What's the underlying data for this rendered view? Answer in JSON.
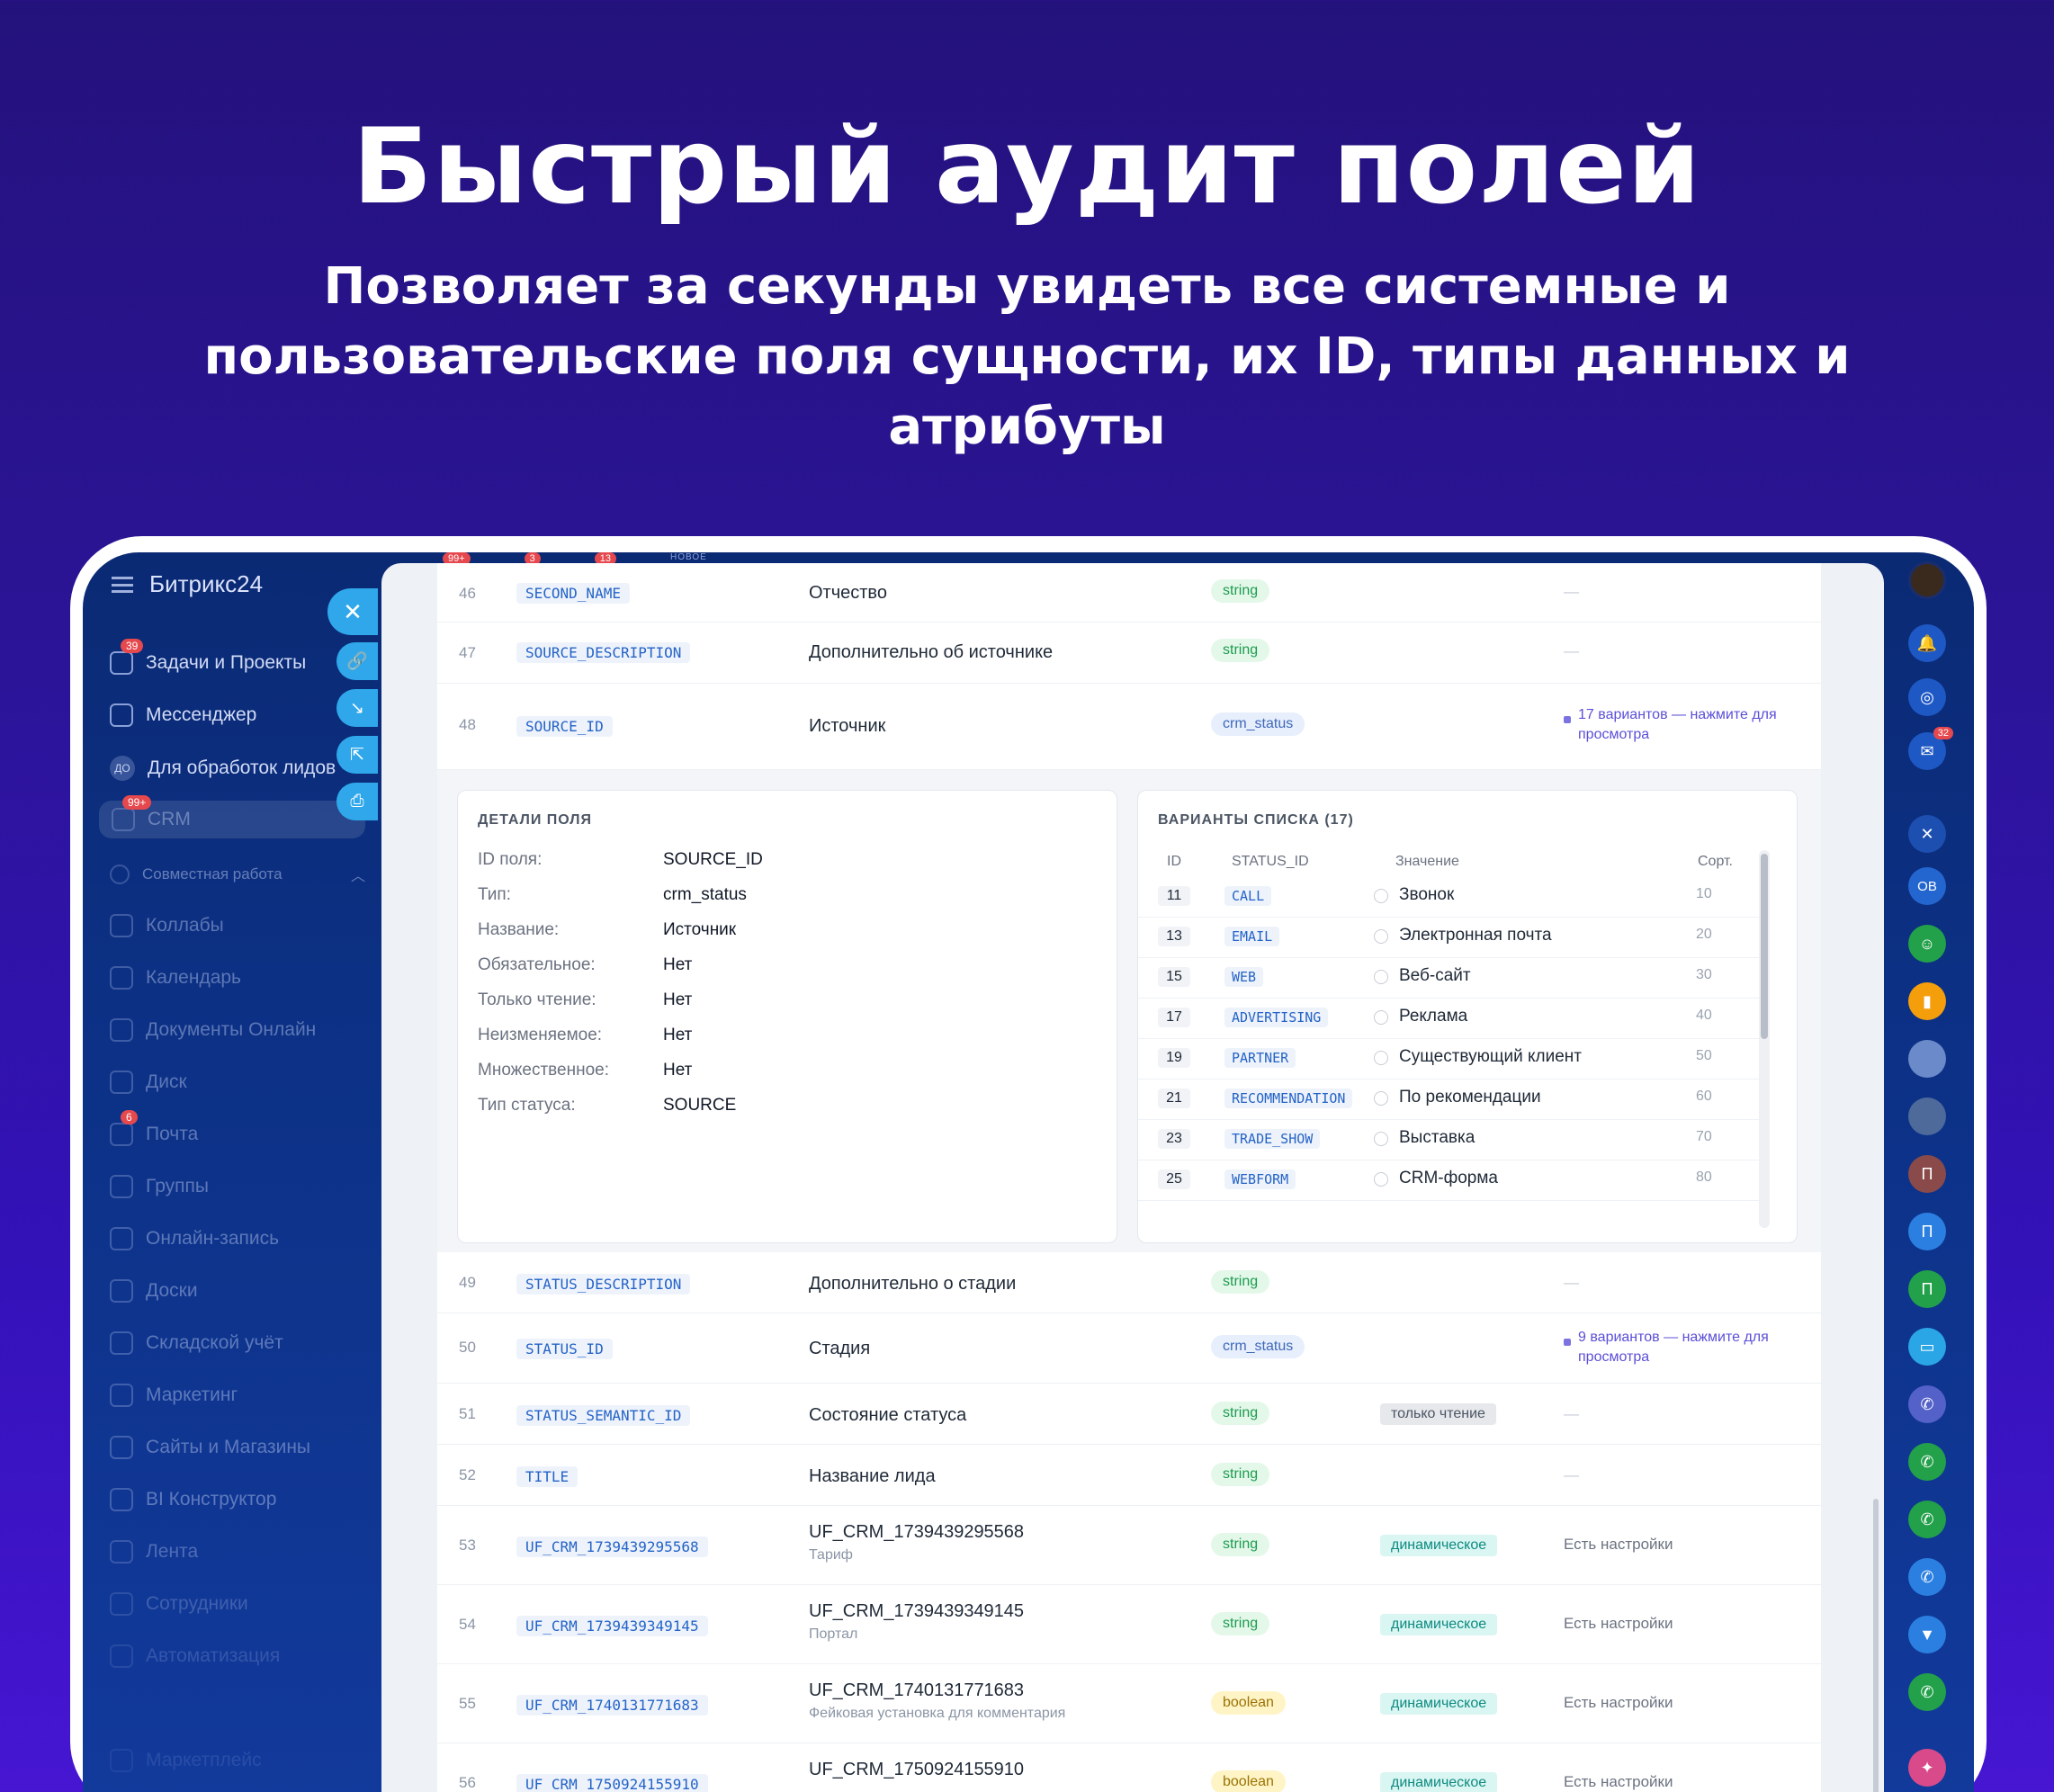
{
  "hero": {
    "title": "Быстрый аудит полей",
    "subtitle_line1": "Позволяет за секунды увидеть все системные и",
    "subtitle_line2": "пользовательские поля сущности, их ID, типы данных и атрибуты"
  },
  "sidebar": {
    "brand": "Битрикс24",
    "items": [
      {
        "label": "Задачи и Проекты",
        "badge": "39"
      },
      {
        "label": "Мессенджер",
        "badge": ""
      },
      {
        "label": "Для обработок лидов",
        "badge": ""
      },
      {
        "label": "CRM",
        "badge": "99+"
      },
      {
        "label": "Коллабы",
        "badge": ""
      },
      {
        "label": "Календарь",
        "badge": ""
      },
      {
        "label": "Документы Онлайн",
        "badge": ""
      },
      {
        "label": "Диск",
        "badge": ""
      },
      {
        "label": "Почта",
        "badge": "6"
      },
      {
        "label": "Группы",
        "badge": ""
      },
      {
        "label": "Онлайн-запись",
        "badge": ""
      },
      {
        "label": "Доски",
        "badge": ""
      },
      {
        "label": "Складской учёт",
        "badge": ""
      },
      {
        "label": "Маркетинг",
        "badge": ""
      },
      {
        "label": "Сайты и Магазины",
        "badge": ""
      },
      {
        "label": "BI Конструктор",
        "badge": ""
      },
      {
        "label": "Лента",
        "badge": ""
      },
      {
        "label": "Сотрудники",
        "badge": ""
      },
      {
        "label": "Автоматизация",
        "badge": ""
      },
      {
        "label": "Маркетплейс",
        "badge": ""
      }
    ],
    "avatar_text": "ДО",
    "section_label": "Совместная работа"
  },
  "top_badges": [
    "99+",
    "3",
    "13"
  ],
  "top_new_label": "НОВОЕ",
  "rail": {
    "bell_badge": "",
    "chat_badge": "32",
    "avatars": [
      "ОВ",
      "П",
      "П",
      "П"
    ]
  },
  "fields": {
    "rows_top": [
      {
        "num": "46",
        "code": "SECOND_NAME",
        "label": "Отчество",
        "type": "string",
        "extra": "—"
      },
      {
        "num": "47",
        "code": "SOURCE_DESCRIPTION",
        "label": "Дополнительно об источнике",
        "type": "string",
        "extra": "—"
      },
      {
        "num": "48",
        "code": "SOURCE_ID",
        "label": "Источник",
        "type": "crm_status",
        "variants": "17 вариантов — нажмите для просмотра"
      }
    ],
    "details": {
      "title": "ДЕТАЛИ ПОЛЯ",
      "rows": [
        {
          "k": "ID поля:",
          "v": "SOURCE_ID"
        },
        {
          "k": "Тип:",
          "v": "crm_status"
        },
        {
          "k": "Название:",
          "v": "Источник"
        },
        {
          "k": "Обязательное:",
          "v": "Нет"
        },
        {
          "k": "Только чтение:",
          "v": "Нет"
        },
        {
          "k": "Неизменяемое:",
          "v": "Нет"
        },
        {
          "k": "Множественное:",
          "v": "Нет"
        },
        {
          "k": "Тип статуса:",
          "v": "SOURCE"
        }
      ]
    },
    "list": {
      "title": "ВАРИАНТЫ СПИСКА (17)",
      "headers": {
        "id": "ID",
        "status": "STATUS_ID",
        "value": "Значение",
        "sort": "Сорт."
      },
      "rows": [
        {
          "id": "11",
          "code": "CALL",
          "value": "Звонок",
          "sort": "10"
        },
        {
          "id": "13",
          "code": "EMAIL",
          "value": "Электронная почта",
          "sort": "20"
        },
        {
          "id": "15",
          "code": "WEB",
          "value": "Веб-сайт",
          "sort": "30"
        },
        {
          "id": "17",
          "code": "ADVERTISING",
          "value": "Реклама",
          "sort": "40"
        },
        {
          "id": "19",
          "code": "PARTNER",
          "value": "Существующий клиент",
          "sort": "50"
        },
        {
          "id": "21",
          "code": "RECOMMENDATION",
          "value": "По рекомендации",
          "sort": "60"
        },
        {
          "id": "23",
          "code": "TRADE_SHOW",
          "value": "Выставка",
          "sort": "70"
        },
        {
          "id": "25",
          "code": "WEBFORM",
          "value": "CRM-форма",
          "sort": "80"
        }
      ]
    },
    "rows_bottom": [
      {
        "num": "49",
        "code": "STATUS_DESCRIPTION",
        "label": "Дополнительно о стадии",
        "sub": "",
        "type": "string",
        "attr": "",
        "extra": "—"
      },
      {
        "num": "50",
        "code": "STATUS_ID",
        "label": "Стадия",
        "sub": "",
        "type": "crm_status",
        "attr": "",
        "variants": "9 вариантов — нажмите для просмотра"
      },
      {
        "num": "51",
        "code": "STATUS_SEMANTIC_ID",
        "label": "Состояние статуса",
        "sub": "",
        "type": "string",
        "attr": "только чтение",
        "extra": "—"
      },
      {
        "num": "52",
        "code": "TITLE",
        "label": "Название лида",
        "sub": "",
        "type": "string",
        "attr": "",
        "extra": "—"
      },
      {
        "num": "53",
        "code": "UF_CRM_1739439295568",
        "label": "UF_CRM_1739439295568",
        "sub": "Тариф",
        "type": "string",
        "attr": "динамическое",
        "extra": "Есть настройки"
      },
      {
        "num": "54",
        "code": "UF_CRM_1739439349145",
        "label": "UF_CRM_1739439349145",
        "sub": "Портал",
        "type": "string",
        "attr": "динамическое",
        "extra": "Есть настройки"
      },
      {
        "num": "55",
        "code": "UF_CRM_1740131771683",
        "label": "UF_CRM_1740131771683",
        "sub": "Фейковая установка для комментария",
        "type": "boolean",
        "attr": "динамическое",
        "extra": "Есть настройки"
      },
      {
        "num": "56",
        "code": "UF_CRM_1750924155910",
        "label": "UF_CRM_1750924155910",
        "sub": "",
        "type": "boolean",
        "attr": "динамическое",
        "extra": "Есть настройки"
      }
    ]
  }
}
